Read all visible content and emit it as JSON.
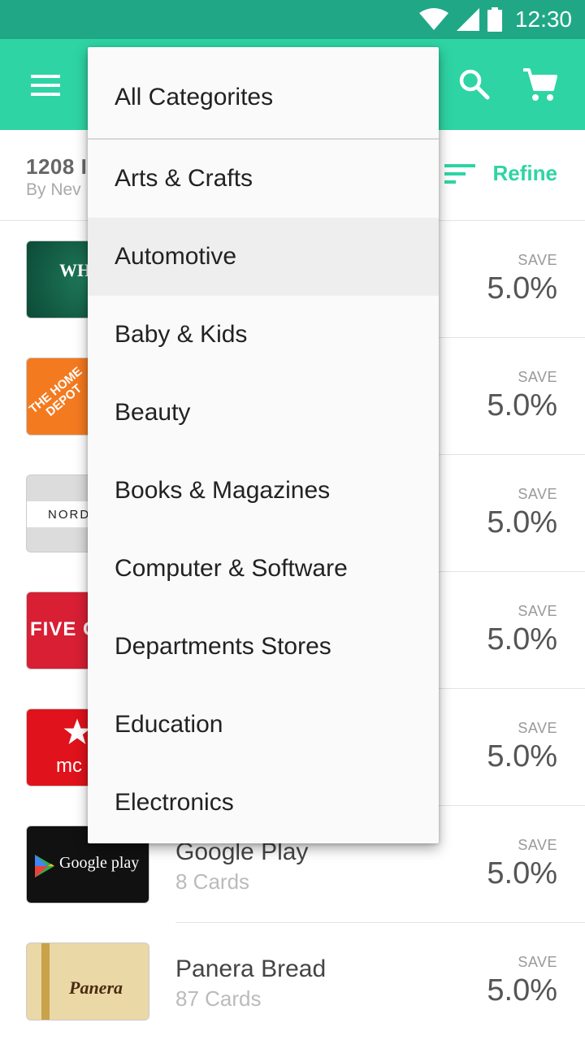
{
  "status_bar": {
    "time": "12:30"
  },
  "sub_header": {
    "count": "1208 I",
    "sort": "By Nev",
    "refine_label": "Refine"
  },
  "cards": [
    {
      "name": "",
      "count": "",
      "save_label": "SAVE",
      "save_value": "5.0%",
      "thumb_text": "WHO FOO"
    },
    {
      "name": "",
      "count": "",
      "save_label": "SAVE",
      "save_value": "5.0%",
      "thumb_text": "THE HOME DEPOT"
    },
    {
      "name": "",
      "count": "",
      "save_label": "SAVE",
      "save_value": "5.0%",
      "thumb_text": "NORD"
    },
    {
      "name": "",
      "count": "",
      "save_label": "SAVE",
      "save_value": "5.0%",
      "thumb_text": "FIVE G"
    },
    {
      "name": "",
      "count": "",
      "save_label": "SAVE",
      "save_value": "5.0%",
      "thumb_text": "mc"
    },
    {
      "name": "Google Play",
      "count": "8 Cards",
      "save_label": "SAVE",
      "save_value": "5.0%",
      "thumb_text": "Google play"
    },
    {
      "name": "Panera Bread",
      "count": "87 Cards",
      "save_label": "SAVE",
      "save_value": "5.0%",
      "thumb_text": "Panera"
    }
  ],
  "dropdown": {
    "items": [
      "All Categorites",
      "Arts & Crafts",
      "Automotive",
      "Baby & Kids",
      "Beauty",
      "Books & Magazines",
      "Computer & Software",
      "Departments Stores",
      "Education",
      "Electronics"
    ],
    "selected": "Automotive"
  },
  "colors": {
    "accent": "#2ed4a4",
    "status_bar": "#20a886"
  }
}
